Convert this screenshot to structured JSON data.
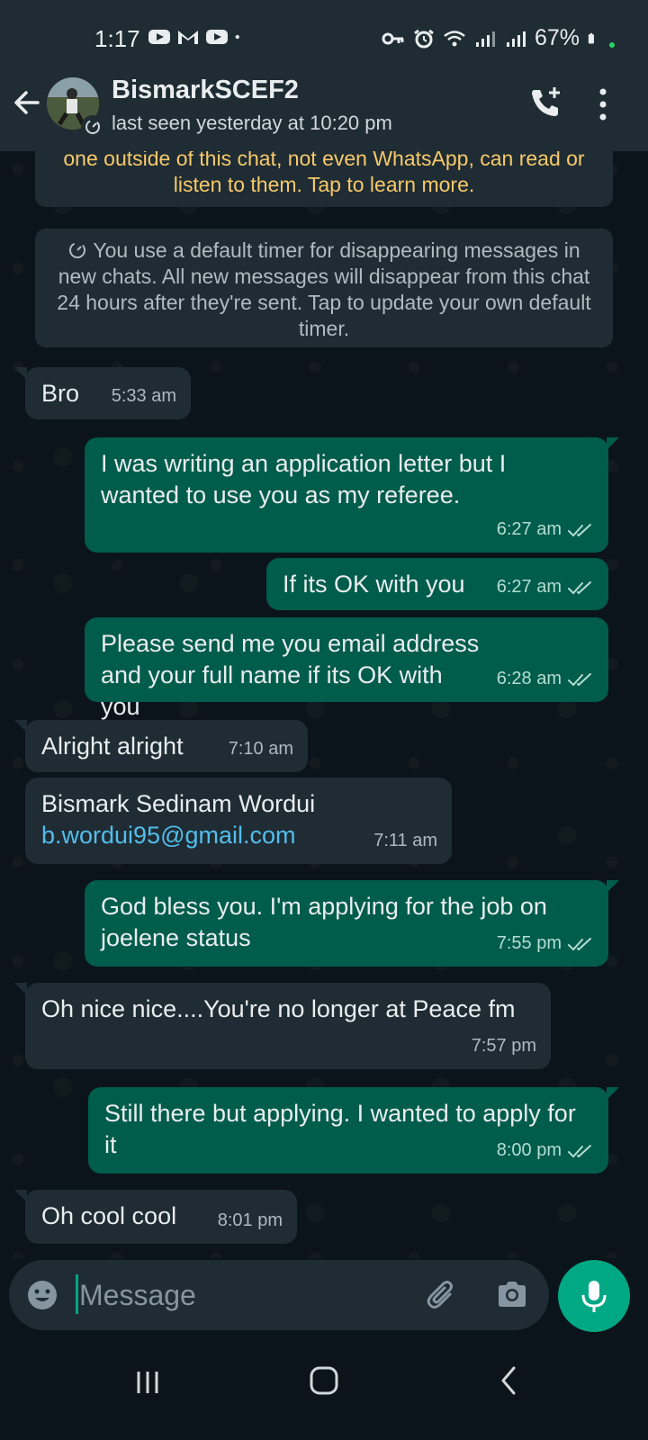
{
  "status_bar": {
    "time": "1:17",
    "battery": "67%",
    "left_icons": [
      "youtube-icon",
      "gmail-icon",
      "youtube-icon",
      "dot-icon"
    ],
    "right_icons": [
      "key-icon",
      "alarm-icon",
      "wifi-icon",
      "signal-icon",
      "signal-icon",
      "battery-icon"
    ]
  },
  "header": {
    "contact_name": "BismarkSCEF2",
    "last_seen": "last seen yesterday at 10:20 pm"
  },
  "system_messages": {
    "encryption": "one outside of this chat, not even WhatsApp, can read or listen to them. Tap to learn more.",
    "timer": "You use a default timer for disappearing messages in new chats. All new messages will disappear from this chat 24 hours after they're sent. Tap to update your own default timer."
  },
  "messages": [
    {
      "dir": "in",
      "text": "Bro",
      "time": "5:33 am"
    },
    {
      "dir": "out",
      "text": "I was writing an application letter but I wanted to use you as my referee.",
      "time": "6:27 am"
    },
    {
      "dir": "out",
      "text": "If its OK with you",
      "time": "6:27 am"
    },
    {
      "dir": "out",
      "text": "Please send me you email address and your full name if its OK with you",
      "time": "6:28 am"
    },
    {
      "dir": "in",
      "text": "Alright alright",
      "time": "7:10 am"
    },
    {
      "dir": "in",
      "text": "Bismark Sedinam Wordui",
      "link": "b.wordui95@gmail.com",
      "time": "7:11 am"
    },
    {
      "dir": "out",
      "text": "God bless you.  I'm applying for the job on joelene status",
      "time": "7:55 pm"
    },
    {
      "dir": "in",
      "text": "Oh nice nice....You're no longer at Peace fm",
      "time": "7:57 pm"
    },
    {
      "dir": "out",
      "text": "Still there but applying.  I wanted to apply for it",
      "time": "8:00 pm"
    },
    {
      "dir": "in",
      "text": "Oh cool cool",
      "time": "8:01 pm"
    }
  ],
  "input": {
    "placeholder": "Message"
  },
  "colors": {
    "header_bg": "#1f2c34",
    "incoming_bubble": "#1f2c34",
    "outgoing_bubble": "#005c4b",
    "accent": "#00a884",
    "link": "#53bdeb",
    "encryption_text": "#f7c96a"
  }
}
